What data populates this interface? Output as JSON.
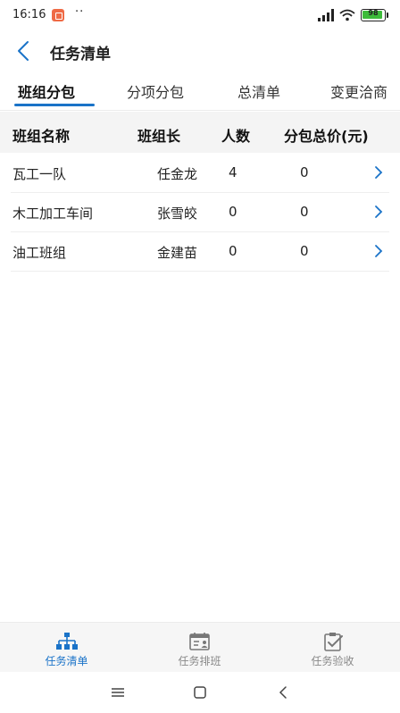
{
  "status": {
    "time": "16:16",
    "dots": "··",
    "battery": "98",
    "battery_level": 0.98
  },
  "header": {
    "title": "任务清单"
  },
  "tabs": [
    {
      "label": "班组分包",
      "active": true
    },
    {
      "label": "分项分包",
      "active": false
    },
    {
      "label": "总清单",
      "active": false
    },
    {
      "label": "变更洽商",
      "active": false
    }
  ],
  "table": {
    "columns": [
      "班组名称",
      "班组长",
      "人数",
      "分包总价(元)"
    ],
    "rows": [
      {
        "name": "瓦工一队",
        "leader": "任金龙",
        "count": "4",
        "total": "0"
      },
      {
        "name": "木工加工车间",
        "leader": "张雪皎",
        "count": "0",
        "total": "0"
      },
      {
        "name": "油工班组",
        "leader": "金建苗",
        "count": "0",
        "total": "0"
      }
    ]
  },
  "bottom_nav": [
    {
      "label": "任务清单",
      "icon": "org-chart-icon",
      "active": true
    },
    {
      "label": "任务排班",
      "icon": "calendar-person-icon",
      "active": false
    },
    {
      "label": "任务验收",
      "icon": "clipboard-check-icon",
      "active": false
    }
  ],
  "colors": {
    "accent": "#1a73c8",
    "battery": "#3dbb3a",
    "app_badge": "#ef6a45"
  }
}
